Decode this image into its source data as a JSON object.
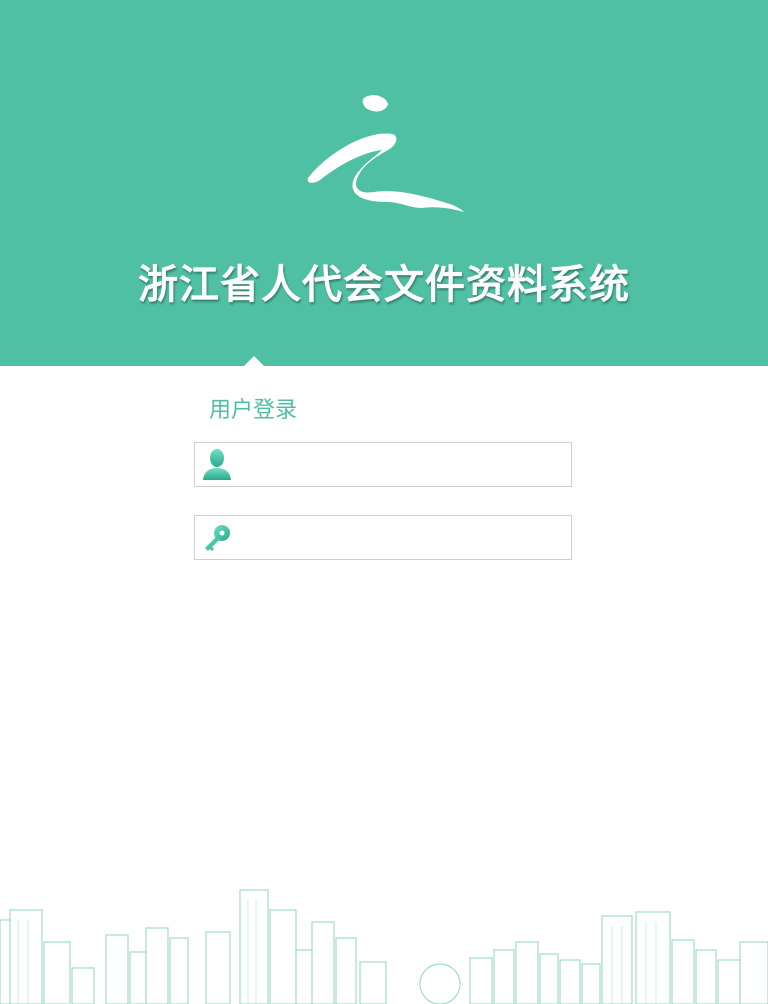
{
  "header": {
    "title": "浙江省人代会文件资料系统",
    "logo_icon": "calligraphy-logo-icon",
    "background_color": "#50c0a4"
  },
  "login": {
    "heading": "用户登录",
    "accent_color": "#4fbfa3",
    "username": {
      "value": "",
      "icon": "user-icon"
    },
    "password": {
      "value": "",
      "icon": "key-icon"
    }
  },
  "footer": {
    "decoration": "city-skyline-illustration"
  }
}
